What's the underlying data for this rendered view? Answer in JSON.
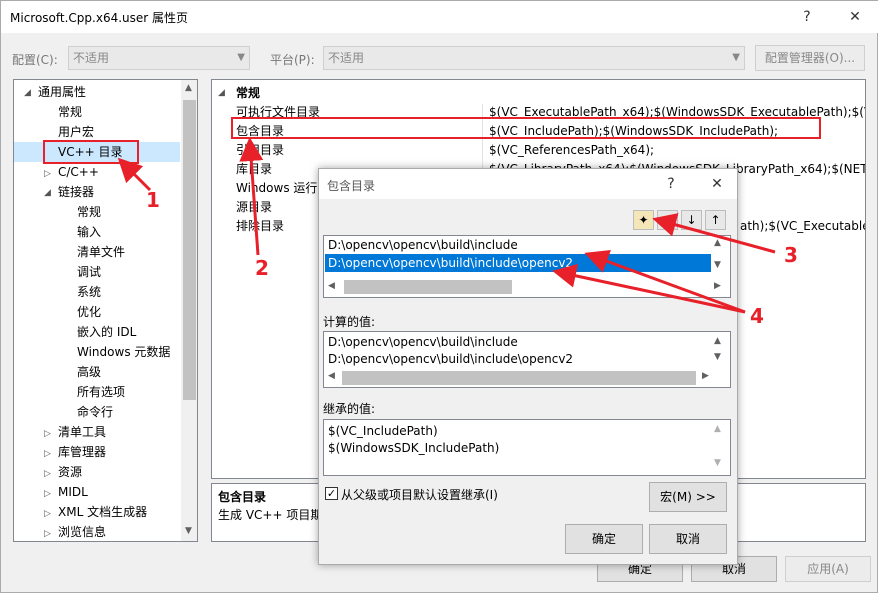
{
  "window": {
    "title": "Microsoft.Cpp.x64.user 属性页",
    "help_glyph": "?",
    "close_glyph": "✕"
  },
  "toolbar": {
    "config_label": "配置(C):",
    "config_value": "不适用",
    "platform_label": "平台(P):",
    "platform_value": "不适用",
    "config_manager": "配置管理器(O)..."
  },
  "tree": {
    "root": "通用属性",
    "items": [
      "常规",
      "用户宏",
      "VC++ 目录",
      "C/C++",
      "链接器"
    ],
    "linker_children": [
      "常规",
      "输入",
      "清单文件",
      "调试",
      "系统",
      "优化",
      "嵌入的 IDL",
      "Windows 元数据",
      "高级",
      "所有选项",
      "命令行"
    ],
    "after": [
      "清单工具",
      "库管理器",
      "资源",
      "MIDL",
      "XML 文档生成器",
      "浏览信息"
    ]
  },
  "grid": {
    "section": "常规",
    "rows": [
      {
        "name": "可执行文件目录",
        "value": "$(VC_ExecutablePath_x64);$(WindowsSDK_ExecutablePath);$(VS_E"
      },
      {
        "name": "包含目录",
        "value": "$(VC_IncludePath);$(WindowsSDK_IncludePath);"
      },
      {
        "name": "引用目录",
        "value": "$(VC_ReferencesPath_x64);"
      },
      {
        "name": "库目录",
        "value": "$(VC_LibraryPath_x64);$(WindowsSDK_LibraryPath_x64);$(NETFXK"
      },
      {
        "name": "Windows 运行",
        "value": ""
      },
      {
        "name": "源目录",
        "value": ""
      },
      {
        "name": "排除目录",
        "value": "ath);$(VC_ExecutablePa"
      }
    ]
  },
  "description": {
    "title": "包含目录",
    "text": "生成 VC++ 项目期"
  },
  "footer": {
    "ok": "确定",
    "cancel": "取消",
    "apply": "应用(A)"
  },
  "dialog": {
    "title": "包含目录",
    "help_glyph": "?",
    "close_glyph": "✕",
    "entries": [
      "D:\\opencv\\opencv\\build\\include",
      "D:\\opencv\\opencv\\build\\include\\opencv2"
    ],
    "computed_label": "计算的值:",
    "computed": [
      "D:\\opencv\\opencv\\build\\include",
      "D:\\opencv\\opencv\\build\\include\\opencv2"
    ],
    "inherited_label": "继承的值:",
    "inherited": [
      "$(VC_IncludePath)",
      "$(WindowsSDK_IncludePath)"
    ],
    "inherit_checkbox": "从父级或项目默认设置继承(I)",
    "macro_button": "宏(M) >>",
    "ok": "确定",
    "cancel": "取消"
  },
  "annotations": [
    "1",
    "2",
    "3",
    "4"
  ],
  "colors": {
    "selection": "#0078d7",
    "annotation": "#e8202a",
    "tree_selected": "#cce8ff"
  }
}
